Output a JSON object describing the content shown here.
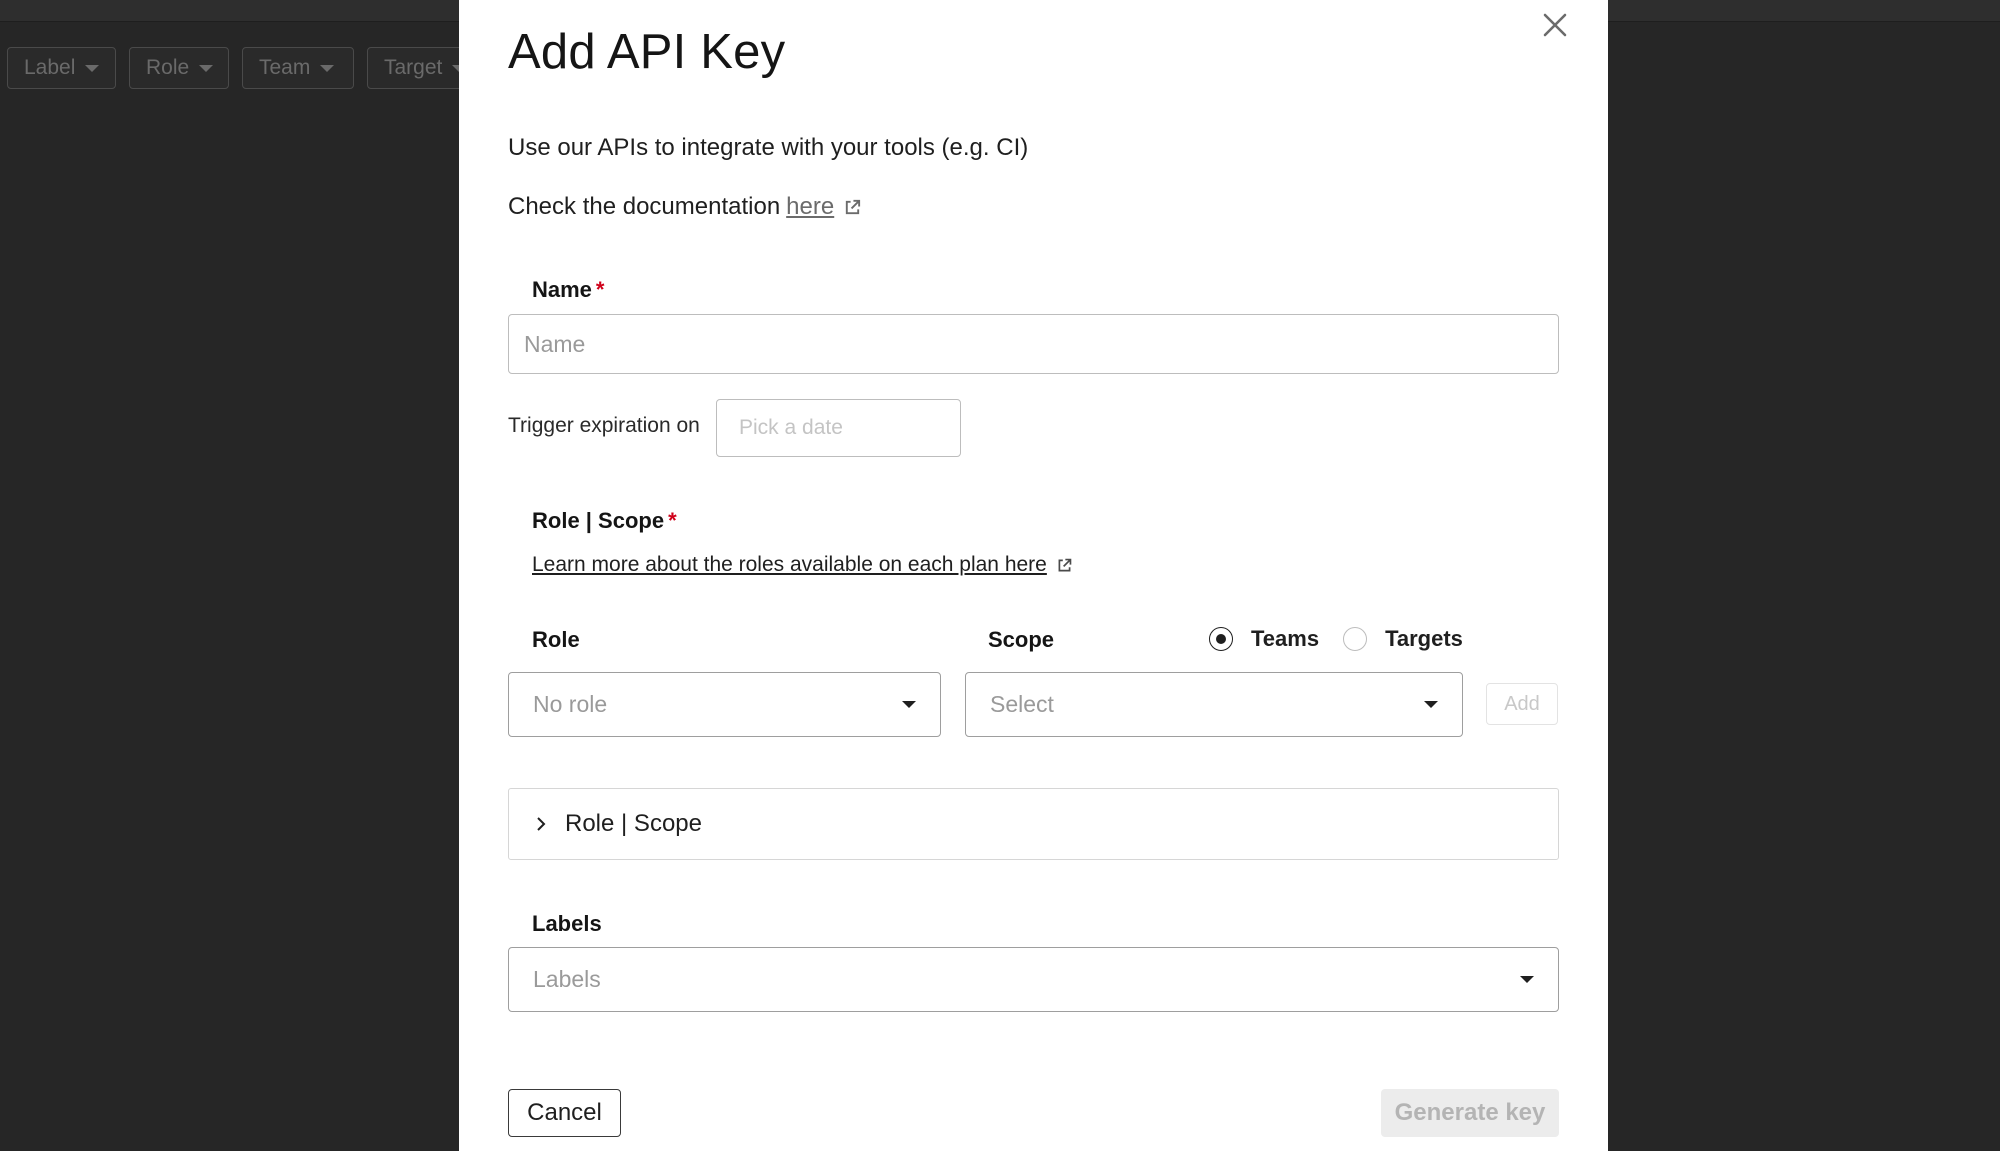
{
  "background": {
    "filters": [
      {
        "label": "Label"
      },
      {
        "label": "Role"
      },
      {
        "label": "Team"
      },
      {
        "label": "Target"
      }
    ]
  },
  "modal": {
    "title": "Add API Key",
    "subtitle": "Use our APIs to integrate with your tools (e.g. CI)",
    "doc_prefix": "Check the documentation",
    "doc_link": "here",
    "name": {
      "label": "Name",
      "required_mark": "*",
      "placeholder": "Name",
      "value": ""
    },
    "expiration": {
      "label": "Trigger expiration on",
      "placeholder": "Pick a date"
    },
    "role_scope": {
      "label": "Role | Scope",
      "required_mark": "*",
      "learn_more": "Learn more about the roles available on each plan here",
      "role_label": "Role",
      "role_value": "No role",
      "scope_label": "Scope",
      "scope_value": "Select",
      "radio_teams": "Teams",
      "radio_targets": "Targets",
      "selected_radio": "Teams",
      "add_label": "Add",
      "accordion_label": "Role | Scope"
    },
    "labels": {
      "label": "Labels",
      "placeholder": "Labels"
    },
    "footer": {
      "cancel_label": "Cancel",
      "generate_label": "Generate key"
    }
  }
}
